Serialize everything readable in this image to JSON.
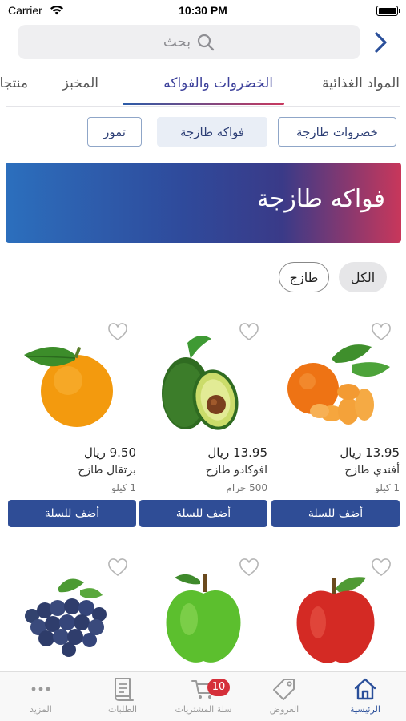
{
  "status_bar": {
    "carrier": "Carrier",
    "time": "10:30 PM"
  },
  "search": {
    "placeholder": "بحث"
  },
  "tabs": [
    {
      "label": "المواد الغذائية"
    },
    {
      "label": "الخضروات والفواكه",
      "active": true
    },
    {
      "label": "المخبز"
    },
    {
      "label": "منتجات"
    }
  ],
  "subcategories": [
    {
      "label": "خضروات طازجة"
    },
    {
      "label": "فواكه طازجة",
      "selected": true
    },
    {
      "label": "تمور"
    }
  ],
  "banner": {
    "title": "فواكه طازجة"
  },
  "filters": [
    {
      "label": "الكل",
      "selected": true
    },
    {
      "label": "طازج"
    }
  ],
  "products": [
    {
      "price": "13.95 ريال",
      "name": "أفندي طازج",
      "weight": "1 كيلو",
      "add_label": "أضف للسلة",
      "icon": "tangerine"
    },
    {
      "price": "13.95 ريال",
      "name": "افوكادو طازج",
      "weight": "500 جرام",
      "add_label": "أضف للسلة",
      "icon": "avocado"
    },
    {
      "price": "9.50 ريال",
      "name": "برتقال طازج",
      "weight": "1 كيلو",
      "add_label": "أضف للسلة",
      "icon": "orange"
    },
    {
      "icon": "red-apple"
    },
    {
      "icon": "green-apple"
    },
    {
      "icon": "blueberries"
    }
  ],
  "bottom_nav": [
    {
      "label": "الرئيسية",
      "icon": "home-icon",
      "active": true
    },
    {
      "label": "العروض",
      "icon": "tag-icon"
    },
    {
      "label": "سلة المشتريات",
      "icon": "cart-icon",
      "badge": "10"
    },
    {
      "label": "الطلبات",
      "icon": "orders-icon"
    },
    {
      "label": "المزيد",
      "icon": "more-icon"
    }
  ],
  "colors": {
    "brand_blue": "#2f4d96",
    "brand_red": "#c8375b",
    "badge_red": "#d52f3a"
  }
}
